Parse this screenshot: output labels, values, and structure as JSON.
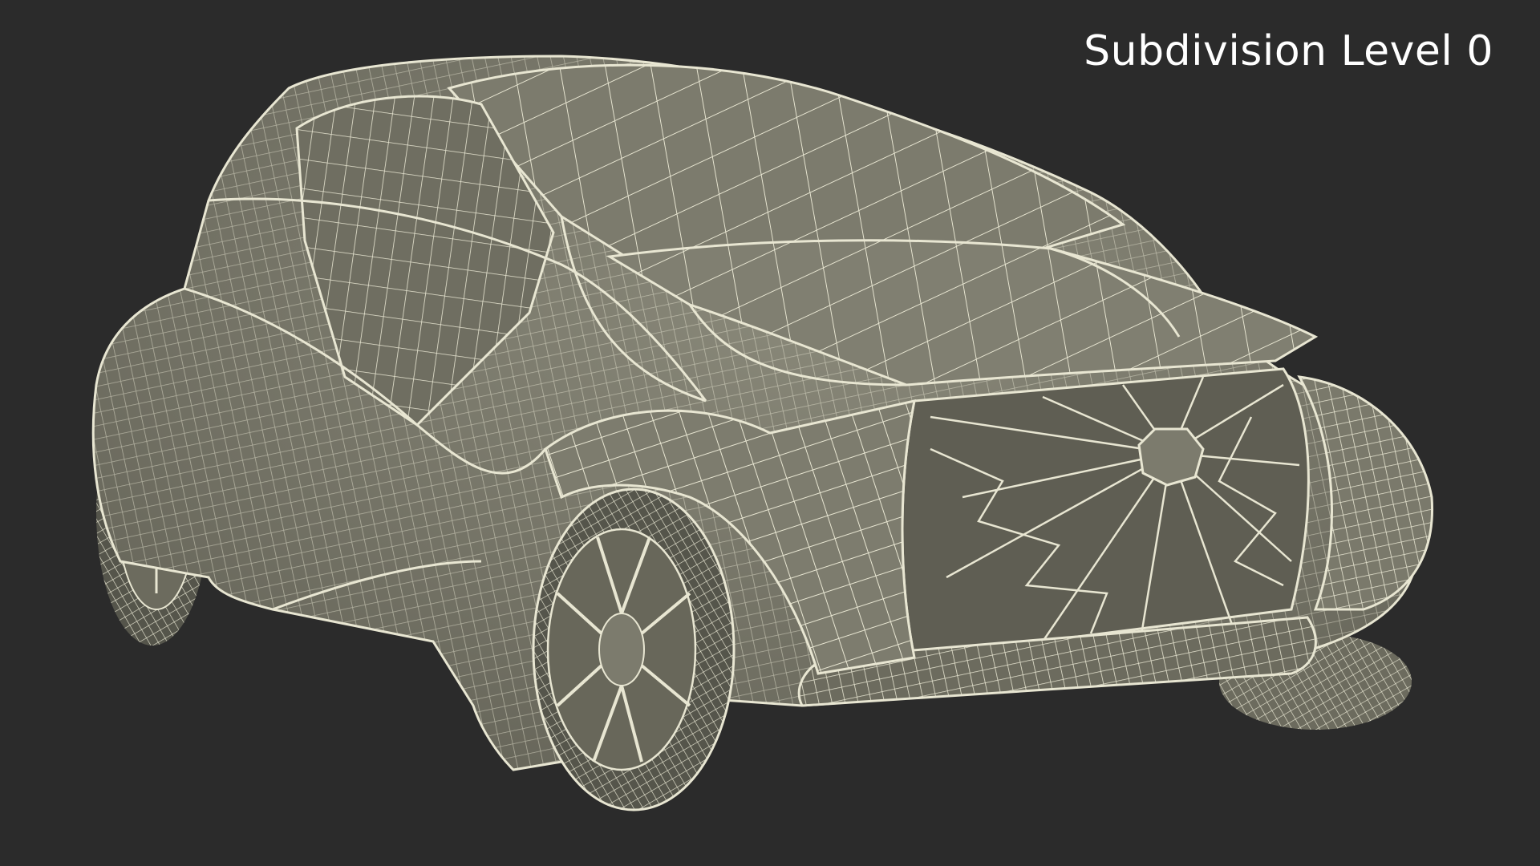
{
  "render_label": "Subdivision Level 0",
  "colors": {
    "background": "#2b2b2b",
    "body_fill": "#7f7e6f",
    "body_shade": "#6c6b5e",
    "body_dark": "#55554b",
    "wire": "#e8e6d2",
    "label_text": "#ffffff"
  },
  "subject": {
    "icon": "wireframe-car-icon"
  }
}
